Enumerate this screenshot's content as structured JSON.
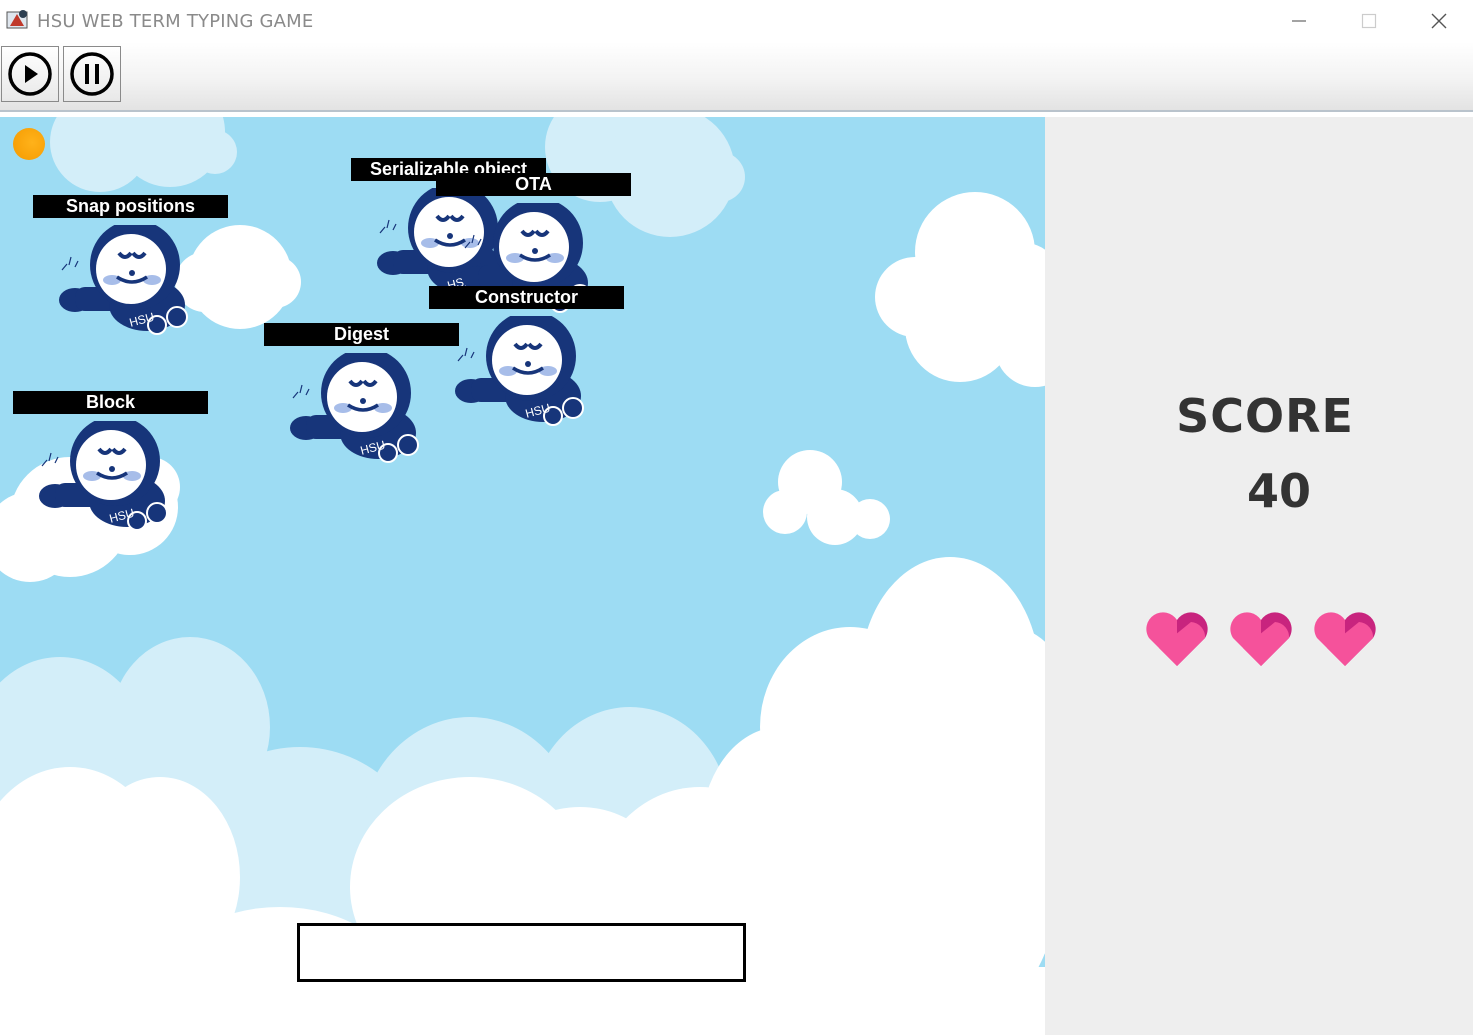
{
  "window": {
    "title": "HSU WEB TERM TYPING GAME"
  },
  "toolbar": {
    "play_icon": "play-icon",
    "pause_icon": "pause-icon"
  },
  "game": {
    "indicator_icon": "orange-dot-icon",
    "words": [
      {
        "text": "Snap positions"
      },
      {
        "text": "Serializable object"
      },
      {
        "text": "OTA"
      },
      {
        "text": "Constructor"
      },
      {
        "text": "Digest"
      },
      {
        "text": "Block"
      }
    ],
    "input": {
      "value": "",
      "placeholder": ""
    }
  },
  "panel": {
    "score_label": "SCORE",
    "score_value": "40",
    "lives": 3,
    "heart_colors": [
      "#f5529b",
      "#c8247e"
    ]
  }
}
